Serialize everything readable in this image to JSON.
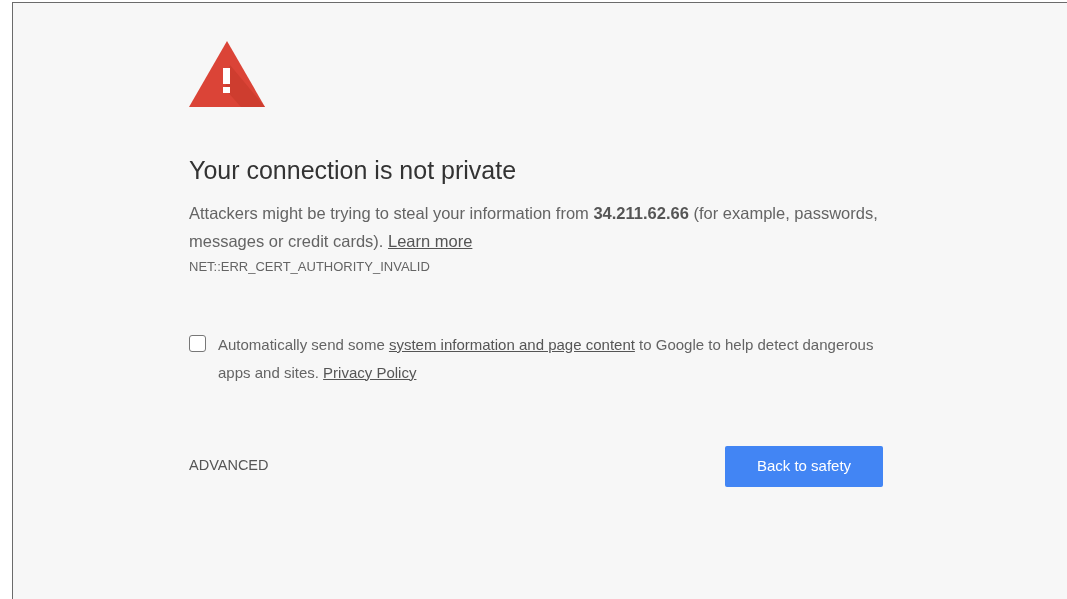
{
  "heading": "Your connection is not private",
  "message": {
    "parts": [
      {
        "kind": "text",
        "text": "Attackers might be trying to steal your information from **34.211.62.66** (for example, passwords, messages or credit cards). "
      },
      {
        "kind": "link",
        "text": "Learn more"
      }
    ]
  },
  "error_code": "NET::ERR_CERT_AUTHORITY_INVALID",
  "report_option": {
    "checked": false,
    "parts": [
      {
        "kind": "text",
        "text": "Automatically send some "
      },
      {
        "kind": "link",
        "text": "system information and page content"
      },
      {
        "kind": "text",
        "text": " to Google to help detect dangerous apps and sites. "
      },
      {
        "kind": "link",
        "text": "Privacy Policy"
      }
    ]
  },
  "advanced_label": "ADVANCED",
  "primary_button": "Back to safety"
}
